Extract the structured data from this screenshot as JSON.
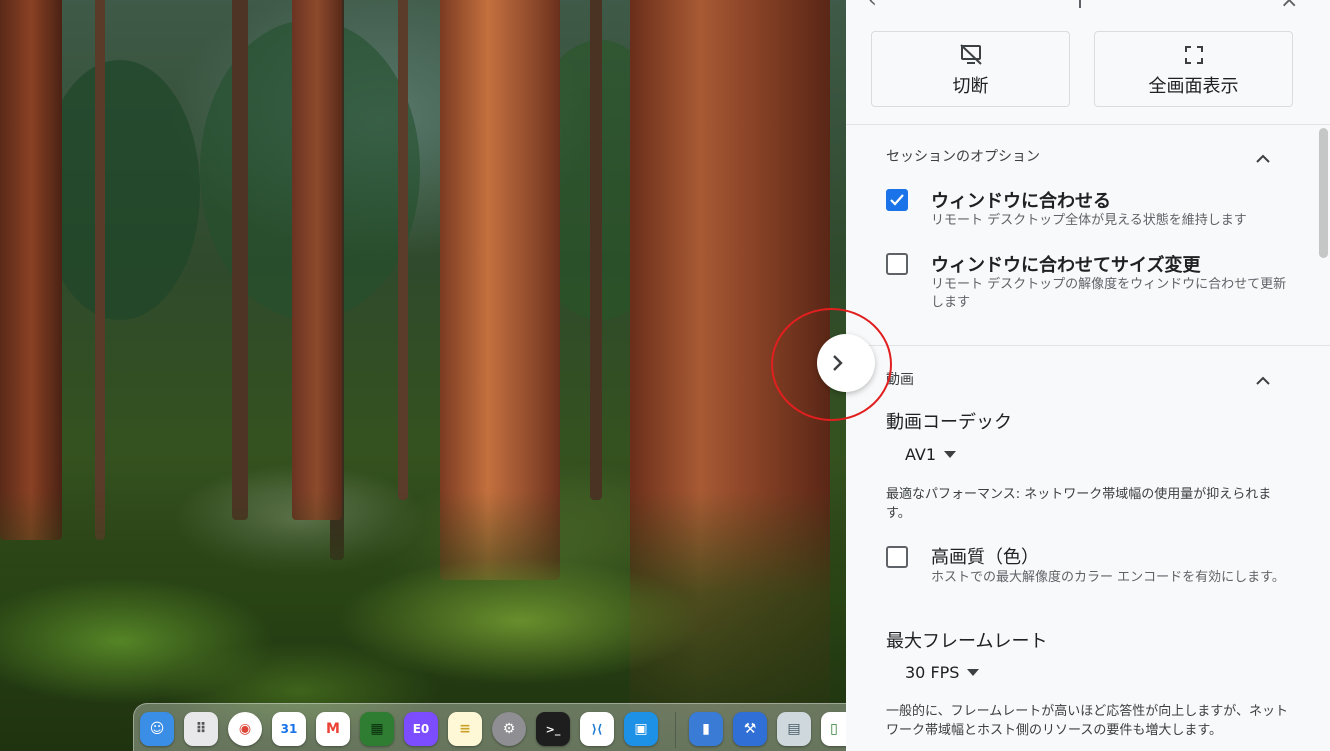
{
  "panel": {
    "actions": {
      "disconnect_label": "切断",
      "fullscreen_label": "全画面表示"
    },
    "session_options": {
      "heading": "セッションのオプション",
      "fit_window": {
        "title": "ウィンドウに合わせる",
        "description": "リモート デスクトップ全体が見える状態を維持します",
        "checked": true
      },
      "resize_to_fit": {
        "title": "ウィンドウに合わせてサイズ変更",
        "description": "リモート デスクトップの解像度をウィンドウに合わせて更新します",
        "checked": false
      }
    },
    "video": {
      "heading": "動画",
      "codec_label": "動画コーデック",
      "codec_value": "AV1",
      "codec_help": "最適なパフォーマンス: ネットワーク帯域幅の使用量が抑えられます。",
      "high_quality": {
        "title": "高画質（色）",
        "description": "ホストでの最大解像度のカラー エンコードを有効にします。",
        "checked": false
      },
      "framerate_label": "最大フレームレート",
      "framerate_value": "30 FPS",
      "framerate_help": "一般的に、フレームレートが高いほど応答性が向上しますが、ネットワーク帯域幅とホスト側のリソースの要件も増大します。"
    }
  },
  "dock": {
    "items": [
      {
        "name": "finder-icon",
        "color": "#3a8ee6",
        "glyph": "☺"
      },
      {
        "name": "launchpad-icon",
        "color": "#e8e8ea",
        "glyph": "⠿"
      },
      {
        "name": "chrome-icon",
        "color": "#ffffff",
        "glyph": "◉"
      },
      {
        "name": "google-calendar-icon",
        "color": "#ffffff",
        "glyph": "31"
      },
      {
        "name": "gmail-icon",
        "color": "#ffffff",
        "glyph": "M"
      },
      {
        "name": "minecraft-icon",
        "color": "#2e7d32",
        "glyph": "▦"
      },
      {
        "name": "editor-icon",
        "color": "#7c4dff",
        "glyph": "E0"
      },
      {
        "name": "notes-icon",
        "color": "#fff8d6",
        "glyph": "≡"
      },
      {
        "name": "system-settings-icon",
        "color": "#8e8e93",
        "glyph": "⚙"
      },
      {
        "name": "terminal-icon",
        "color": "#1e1e1e",
        "glyph": ">_"
      },
      {
        "name": "vscode-icon",
        "color": "#ffffff",
        "glyph": "⟩⟨"
      },
      {
        "name": "docker-icon",
        "color": "#1d91e6",
        "glyph": "▣"
      },
      {
        "name": "simulator-icon",
        "color": "#3a7bd5",
        "glyph": "▮"
      },
      {
        "name": "xcode-icon",
        "color": "#2f6fd6",
        "glyph": "⚒"
      },
      {
        "name": "preview-icon",
        "color": "#cfd8dc",
        "glyph": "▤"
      },
      {
        "name": "app-icon-partial",
        "color": "#ffffff",
        "glyph": "▯"
      }
    ]
  },
  "colors": {
    "accent": "#1a73e8",
    "annotation_ring": "#e11f1f"
  }
}
